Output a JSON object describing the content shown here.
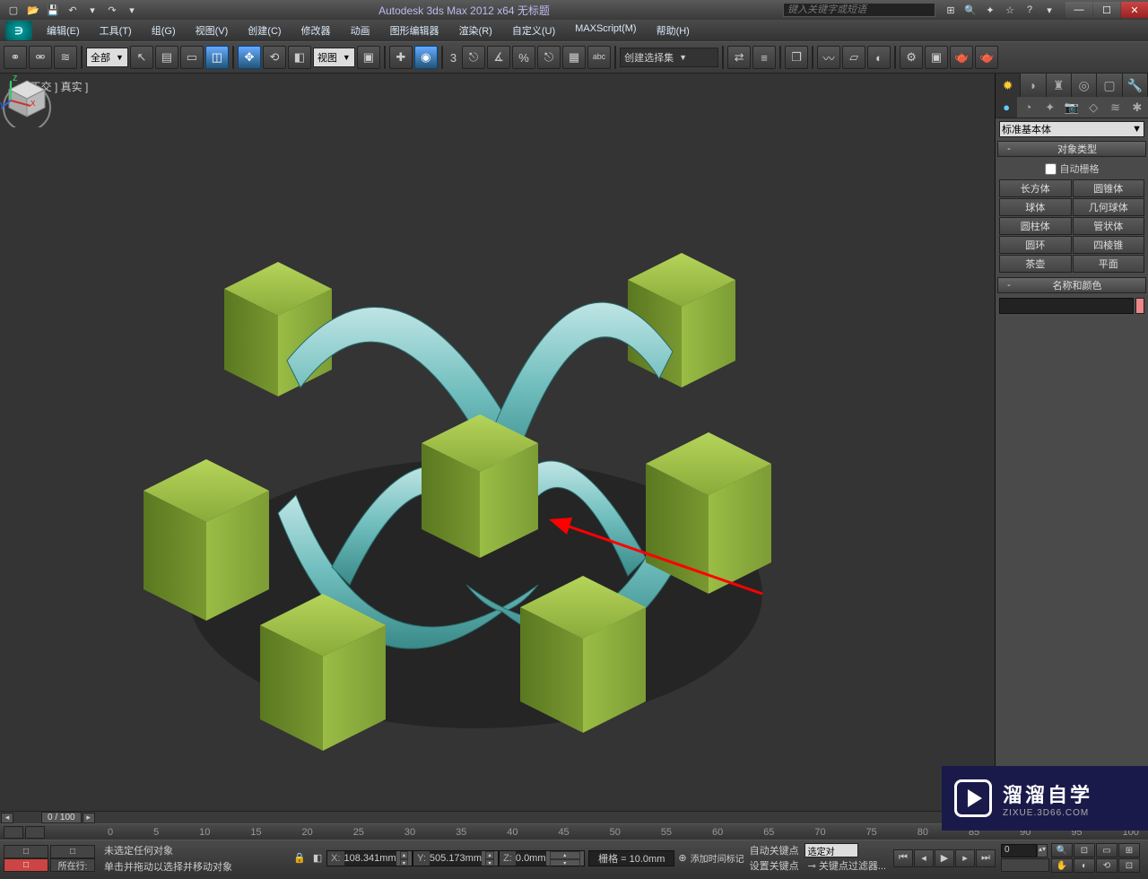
{
  "titlebar": {
    "title": "Autodesk 3ds Max 2012 x64    无标题",
    "search_placeholder": "键入关键字或短语"
  },
  "menu": [
    "编辑(E)",
    "工具(T)",
    "组(G)",
    "视图(V)",
    "创建(C)",
    "修改器",
    "动画",
    "图形编辑器",
    "渲染(R)",
    "自定义(U)",
    "MAXScript(M)",
    "帮助(H)"
  ],
  "toolbar": {
    "filter_all": "全部",
    "view_drop": "视图",
    "named_set": "创建选择集"
  },
  "viewport": {
    "label": "[ + ] 正交 ] 真实  ]"
  },
  "cmdpanel": {
    "dropdown": "标准基本体",
    "roll_objtype": "对象类型",
    "autogrid": "自动栅格",
    "buttons": [
      "长方体",
      "圆锥体",
      "球体",
      "几何球体",
      "圆柱体",
      "管状体",
      "圆环",
      "四棱锥",
      "茶壶",
      "平面"
    ],
    "roll_namecolor": "名称和颜色",
    "name_input": ""
  },
  "timeline": {
    "frame": "0 / 100"
  },
  "track_ticks": [
    "0",
    "5",
    "10",
    "15",
    "20",
    "25",
    "30",
    "35",
    "40",
    "45",
    "50",
    "55",
    "60",
    "65",
    "70",
    "75",
    "80",
    "85",
    "90",
    "95",
    "100"
  ],
  "status": {
    "row_label": "所在行:",
    "prompt1": "未选定任何对象",
    "prompt2": "单击并拖动以选择并移动对象",
    "x": "108.341mm",
    "y": "505.173mm",
    "z": "0.0mm",
    "grid": "栅格 = 10.0mm",
    "autokey": "自动关键点",
    "setkey": "设置关键点",
    "selected": "选定对",
    "keyfilter": "关键点过滤器...",
    "addtime": "添加时间标记"
  },
  "watermark": {
    "big": "溜溜自学",
    "small": "ZIXUE.3D66.COM"
  }
}
